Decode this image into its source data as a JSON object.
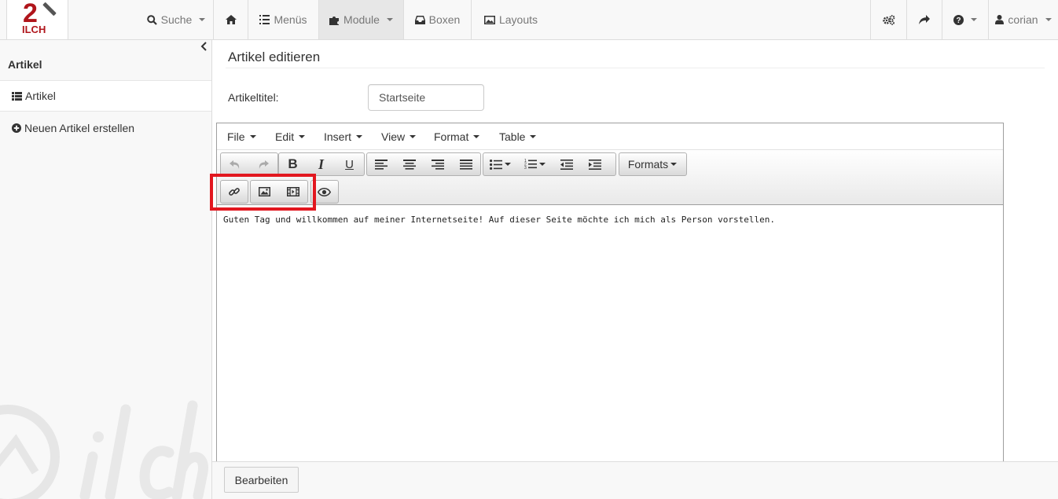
{
  "navbar": {
    "logo_number": "2",
    "logo_text": "ILCH",
    "search_label": "Suche",
    "menus_label": "Menüs",
    "modules_label": "Module",
    "boxes_label": "Boxen",
    "layouts_label": "Layouts",
    "user_label": "corian"
  },
  "sidebar": {
    "title": "Artikel",
    "items": [
      {
        "label": "Artikel",
        "icon": "list-icon"
      },
      {
        "label": "Neuen Artikel erstellen",
        "icon": "plus-circle-icon"
      }
    ]
  },
  "main": {
    "page_title": "Artikel editieren",
    "field_label": "Artikeltitel:",
    "title_value": "Startseite"
  },
  "editor": {
    "menu": [
      "File",
      "Edit",
      "Insert",
      "View",
      "Format",
      "Table"
    ],
    "formats_label": "Formats",
    "content": "Guten Tag und willkommen auf meiner Internetseite! Auf dieser Seite möchte ich mich als Person vorstellen."
  },
  "footer": {
    "submit_label": "Bearbeiten"
  },
  "colors": {
    "logo_red": "#b0151b",
    "highlight_red": "#e2171f"
  }
}
